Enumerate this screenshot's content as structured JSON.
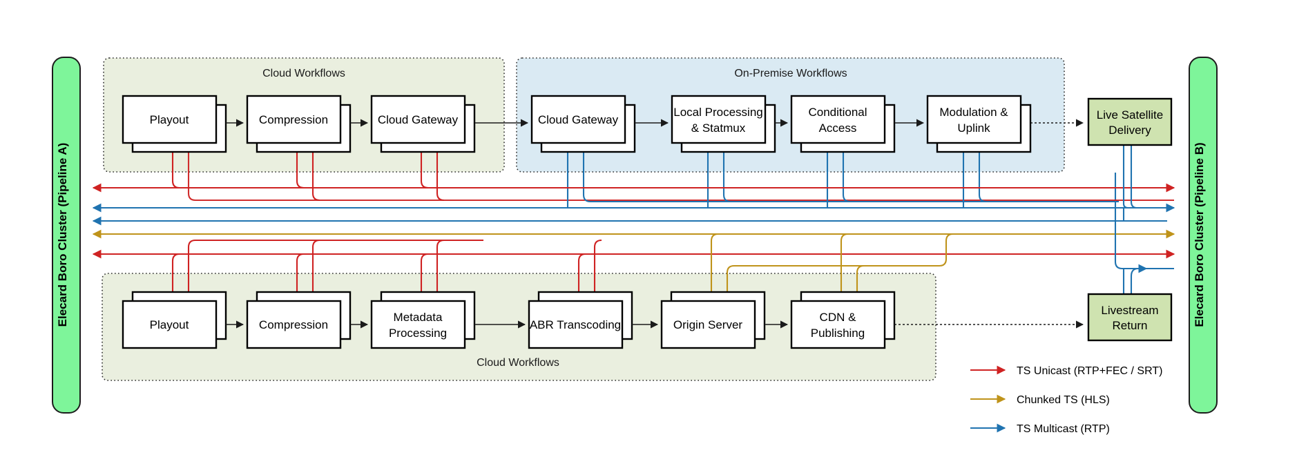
{
  "colors": {
    "unicast_red": "#cf2222",
    "chunked_gold": "#bf931a",
    "multicast_blue": "#1f73b0",
    "cluster_green": "#7ef59a",
    "endpoint_green": "#cfe3b0",
    "cloud_group_bg": "#eaefdf",
    "onprem_group_bg": "#daeaf3",
    "node_fill": "#ffffff",
    "stroke_black": "#000000"
  },
  "clusters": {
    "left": {
      "label": "Elecard Boro Cluster  (Pipeline A)"
    },
    "right": {
      "label": "Elecard Boro Cluster  (Pipeline B)"
    }
  },
  "groups": {
    "top_cloud": {
      "label": "Cloud Workflows"
    },
    "top_onprem": {
      "label": "On-Premise Workflows"
    },
    "bottom_cloud": {
      "label": "Cloud Workflows"
    }
  },
  "top_row": {
    "nodes": [
      {
        "id": "playout-top",
        "label": "Playout"
      },
      {
        "id": "compression-top",
        "label": "Compression"
      },
      {
        "id": "cloud-gateway-out",
        "label": "Cloud Gateway"
      },
      {
        "id": "cloud-gateway-in",
        "label": "Cloud Gateway"
      },
      {
        "id": "local-processing",
        "label": "Local Processing\n& Statmux",
        "line1": "Local Processing",
        "line2": "& Statmux"
      },
      {
        "id": "conditional-access",
        "label": "Conditional\nAccess",
        "line1": "Conditional",
        "line2": "Access"
      },
      {
        "id": "modulation-uplink",
        "label": "Modulation &\nUplink",
        "line1": "Modulation &",
        "line2": "Uplink"
      }
    ],
    "endpoint": {
      "id": "live-satellite-delivery",
      "line1": "Live Satellite",
      "line2": "Delivery"
    }
  },
  "bottom_row": {
    "nodes": [
      {
        "id": "playout-bottom",
        "label": "Playout"
      },
      {
        "id": "compression-bottom",
        "label": "Compression"
      },
      {
        "id": "metadata-processing",
        "label": "Metadata\nProcessing",
        "line1": "Metadata",
        "line2": "Processing"
      },
      {
        "id": "abr-transcoding",
        "label": "ABR Transcoding"
      },
      {
        "id": "origin-server",
        "label": "Origin Server"
      },
      {
        "id": "cdn-publishing",
        "label": "CDN &\nPublishing",
        "line1": "CDN &",
        "line2": "Publishing"
      }
    ],
    "endpoint": {
      "id": "livestream-return",
      "line1": "Livestream",
      "line2": "Return"
    }
  },
  "legend": {
    "items": [
      {
        "id": "legend-ts-unicast",
        "label": "TS Unicast (RTP+FEC / SRT)",
        "color": "#cf2222"
      },
      {
        "id": "legend-chunked-ts",
        "label": "Chunked TS (HLS)",
        "color": "#bf931a"
      },
      {
        "id": "legend-ts-multicast",
        "label": "TS Multicast (RTP)",
        "color": "#1f73b0"
      }
    ]
  }
}
